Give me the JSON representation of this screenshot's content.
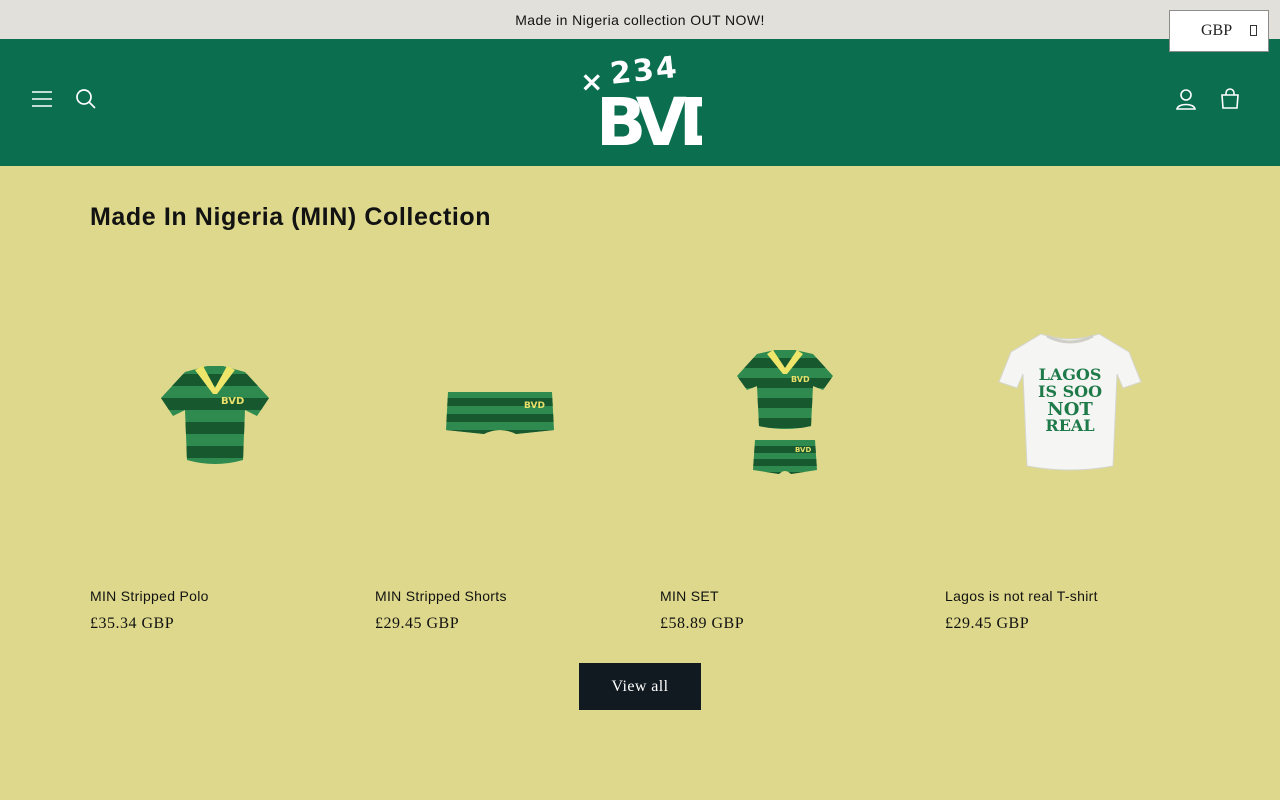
{
  "announcement": "Made in Nigeria collection OUT NOW!",
  "currency": {
    "selected": "GBP"
  },
  "header": {
    "brand": "+234 BVD",
    "icons": [
      "menu-icon",
      "search-icon",
      "account-icon",
      "cart-icon"
    ],
    "colors": {
      "header_bg": "#0b6e4f",
      "page_bg": "#ddd88b",
      "announce_bg": "#e1e0da"
    }
  },
  "collection": {
    "title": "Made In Nigeria (MIN) Collection",
    "products": [
      {
        "name": "MIN Stripped Polo",
        "price": "£35.34 GBP"
      },
      {
        "name": "MIN Stripped Shorts",
        "price": "£29.45 GBP"
      },
      {
        "name": "MIN SET",
        "price": "£58.89 GBP"
      },
      {
        "name": "Lagos is not real T-shirt",
        "price": "£29.45 GBP",
        "print": [
          "LAGOS",
          "IS SOO",
          "NOT",
          "REAL"
        ]
      }
    ],
    "view_all": "View all"
  }
}
